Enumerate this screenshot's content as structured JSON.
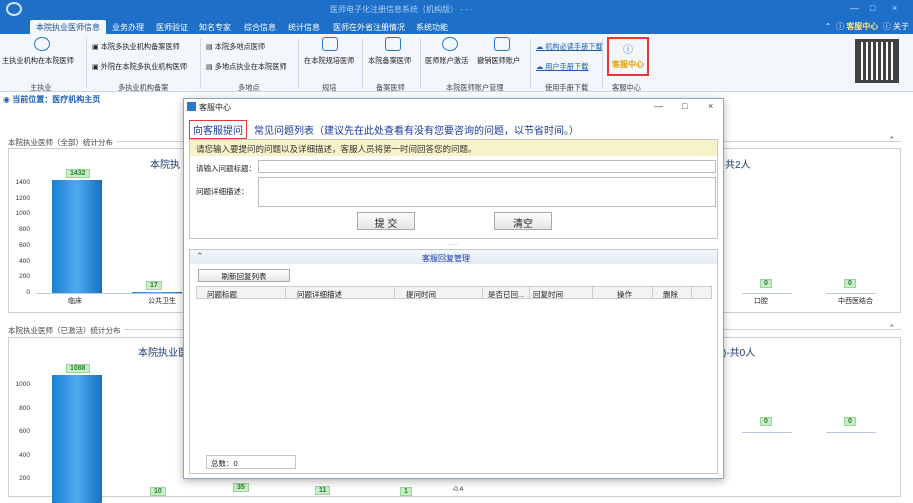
{
  "window": {
    "title": "医师电子化注册信息系统（机构版） - - ·",
    "min": "—",
    "max": "□",
    "close": "×"
  },
  "menu": {
    "tabs": [
      {
        "label": "本院执业医师信息"
      },
      {
        "label": "业务办理"
      },
      {
        "label": "医师验证"
      },
      {
        "label": "知名专家"
      },
      {
        "label": "综合信息"
      },
      {
        "label": "统计信息"
      },
      {
        "label": "医师在外省注册情况"
      },
      {
        "label": "系统功能"
      }
    ],
    "right_caret": "⌃",
    "service_center": "客服中心",
    "about": "关于"
  },
  "ribbon": {
    "items": {
      "main_practice": "主执业机构在本院医师",
      "multi_institution_record": "本院多执业机构备案医师",
      "external_multi_institution": "外院在本院多执业机构医师",
      "multi_location": "本院多地点医师",
      "multi_location_in_hospital": "多地点执业在本院医师",
      "standardized_training": "在本院规培医师",
      "record_doctors": "本院备案医师",
      "account_activate": "医师账户激活",
      "account_cancel": "撤销医师账户",
      "org_manual_download": "机构必读手册下载",
      "user_manual_download": "用户手册下载",
      "service_center": "客服中心"
    },
    "groups": {
      "main": "主执业",
      "multi_record": "多执业机构备案",
      "multi_location": "多地点",
      "training": "规培",
      "record": "备案医师",
      "account_mgmt": "本院医师账户管理",
      "manual_download": "使用手册下载",
      "service": "客服中心"
    }
  },
  "location": "当前位置：医疗机构主页",
  "sections": {
    "all": {
      "title": "本院执业医师（全部）统计分布",
      "left_heading": "本院执",
      "right_heading": "共2人"
    },
    "active": {
      "title": "本院执业医师（已激活）统计分布",
      "left_heading": "本院执业医",
      "right_heading": ")-共0人"
    }
  },
  "chart_data": [
    {
      "type": "bar",
      "title": "",
      "ylim": [
        0,
        1500
      ],
      "yticks": [
        "1400",
        "1200",
        "1000",
        "800",
        "600",
        "400",
        "200",
        "0"
      ],
      "categories": [
        "临床",
        "公共卫生"
      ],
      "values": [
        1432,
        17
      ]
    },
    {
      "type": "bar",
      "title": "",
      "categories": [
        "口腔",
        "中西医结合"
      ],
      "values": [
        0,
        0
      ]
    },
    {
      "type": "bar",
      "title": "",
      "ylim": [
        200,
        1100
      ],
      "yticks": [
        "1000",
        "800",
        "600",
        "400",
        "200"
      ],
      "categories": [
        "",
        "",
        "",
        ""
      ],
      "values": [
        1088,
        10,
        35,
        11
      ]
    },
    {
      "type": "bar",
      "title": "",
      "yticks": [
        "-0.4"
      ],
      "categories": [
        "",
        "",
        ""
      ],
      "values": [
        1,
        0,
        0
      ]
    }
  ],
  "dialog": {
    "title": "客服中心",
    "tab_ask": "向客服提问",
    "tab_faq": "常见问题列表（建议先在此处查看有没有您要咨询的问题，以节省时间。）",
    "notice": "请您输入要提问的问题以及详细描述，客服人员将第一时间回答您的问题。",
    "label_title": "请输入问题标题：",
    "label_detail": "问题详细描述：",
    "title_value": "",
    "detail_value": "",
    "submit": "提 交",
    "clear": "清空",
    "splitter": "·····",
    "reply_title": "客服回复管理",
    "refresh": "刷新回复列表",
    "columns": [
      "问题标题",
      "问题详细描述",
      "提问时间",
      "是否已回...",
      "回复时间",
      "操作",
      "删除"
    ],
    "total": "总数：0"
  }
}
